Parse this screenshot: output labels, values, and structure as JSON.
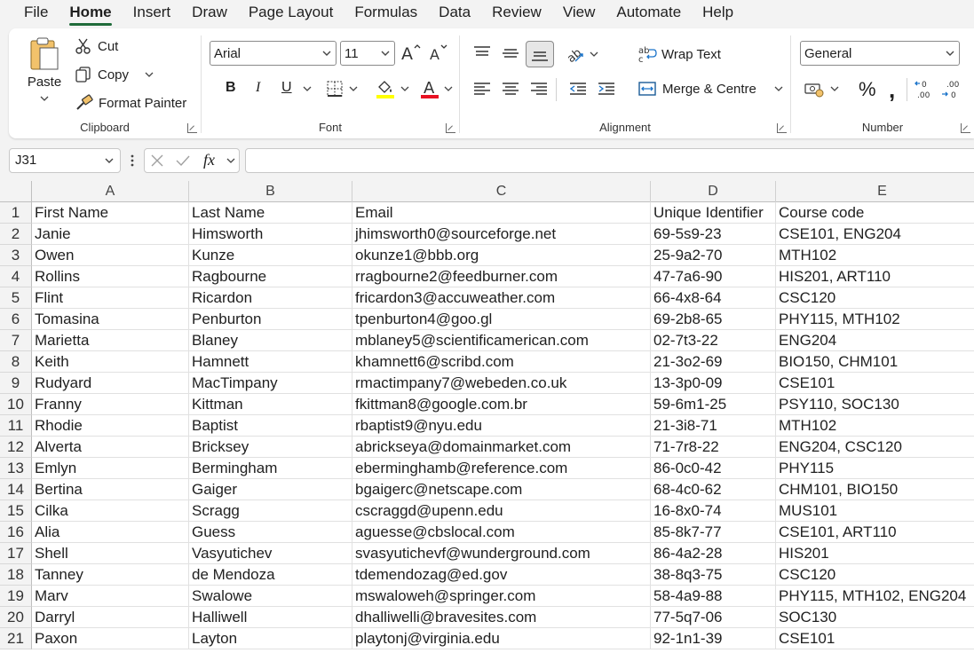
{
  "menu": [
    "File",
    "Home",
    "Insert",
    "Draw",
    "Page Layout",
    "Formulas",
    "Data",
    "Review",
    "View",
    "Automate",
    "Help"
  ],
  "ribbon": {
    "clipboard": {
      "label": "Clipboard",
      "paste": "Paste",
      "cut": "Cut",
      "copy": "Copy",
      "format_painter": "Format Painter"
    },
    "font": {
      "label": "Font",
      "font_name": "Arial",
      "font_size": "11",
      "bold": "B",
      "italic": "I",
      "underline": "U"
    },
    "alignment": {
      "label": "Alignment",
      "wrap_text": "Wrap Text",
      "merge_centre": "Merge & Centre"
    },
    "number": {
      "label": "Number",
      "format": "General",
      "percent": "%",
      "comma": ","
    }
  },
  "formula_bar": {
    "name_box": "J31",
    "fx": "fx",
    "formula": ""
  },
  "grid": {
    "columns": [
      "A",
      "B",
      "C",
      "D",
      "E"
    ],
    "rows": [
      [
        "1",
        "First Name",
        "Last Name",
        "Email",
        "Unique Identifier",
        "Course code"
      ],
      [
        "2",
        "Janie",
        "Himsworth",
        "jhimsworth0@sourceforge.net",
        "69-5s9-23",
        "CSE101, ENG204"
      ],
      [
        "3",
        "Owen",
        "Kunze",
        "okunze1@bbb.org",
        "25-9a2-70",
        "MTH102"
      ],
      [
        "4",
        "Rollins",
        "Ragbourne",
        "rragbourne2@feedburner.com",
        "47-7a6-90",
        "HIS201, ART110"
      ],
      [
        "5",
        "Flint",
        "Ricardon",
        "fricardon3@accuweather.com",
        "66-4x8-64",
        "CSC120"
      ],
      [
        "6",
        "Tomasina",
        "Penburton",
        "tpenburton4@goo.gl",
        "69-2b8-65",
        "PHY115, MTH102"
      ],
      [
        "7",
        "Marietta",
        "Blaney",
        "mblaney5@scientificamerican.com",
        "02-7t3-22",
        "ENG204"
      ],
      [
        "8",
        "Keith",
        "Hamnett",
        "khamnett6@scribd.com",
        "21-3o2-69",
        "BIO150, CHM101"
      ],
      [
        "9",
        "Rudyard",
        "MacTimpany",
        "rmactimpany7@webeden.co.uk",
        "13-3p0-09",
        "CSE101"
      ],
      [
        "10",
        "Franny",
        "Kittman",
        "fkittman8@google.com.br",
        "59-6m1-25",
        "PSY110, SOC130"
      ],
      [
        "11",
        "Rhodie",
        "Baptist",
        "rbaptist9@nyu.edu",
        "21-3i8-71",
        "MTH102"
      ],
      [
        "12",
        "Alverta",
        "Bricksey",
        "abrickseya@domainmarket.com",
        "71-7r8-22",
        "ENG204, CSC120"
      ],
      [
        "13",
        "Emlyn",
        "Bermingham",
        "eberminghamb@reference.com",
        "86-0c0-42",
        "PHY115"
      ],
      [
        "14",
        "Bertina",
        "Gaiger",
        "bgaigerc@netscape.com",
        "68-4c0-62",
        "CHM101, BIO150"
      ],
      [
        "15",
        "Cilka",
        "Scragg",
        "cscraggd@upenn.edu",
        "16-8x0-74",
        "MUS101"
      ],
      [
        "16",
        "Alia",
        "Guess",
        "aguesse@cbslocal.com",
        "85-8k7-77",
        "CSE101, ART110"
      ],
      [
        "17",
        "Shell",
        "Vasyutichev",
        "svasyutichevf@wunderground.com",
        "86-4a2-28",
        "HIS201"
      ],
      [
        "18",
        "Tanney",
        "de Mendoza",
        "tdemendozag@ed.gov",
        "38-8q3-75",
        "CSC120"
      ],
      [
        "19",
        "Marv",
        "Swalowe",
        "mswaloweh@springer.com",
        "58-4a9-88",
        "PHY115, MTH102, ENG204"
      ],
      [
        "20",
        "Darryl",
        "Halliwell",
        "dhalliwelli@bravesites.com",
        "77-5q7-06",
        "SOC130"
      ],
      [
        "21",
        "Paxon",
        "Layton",
        "playtonj@virginia.edu",
        "92-1n1-39",
        "CSE101"
      ]
    ]
  },
  "colors": {
    "accent": "#1f6b3a",
    "font_color": "#e81123",
    "highlight": "#ffff00"
  }
}
